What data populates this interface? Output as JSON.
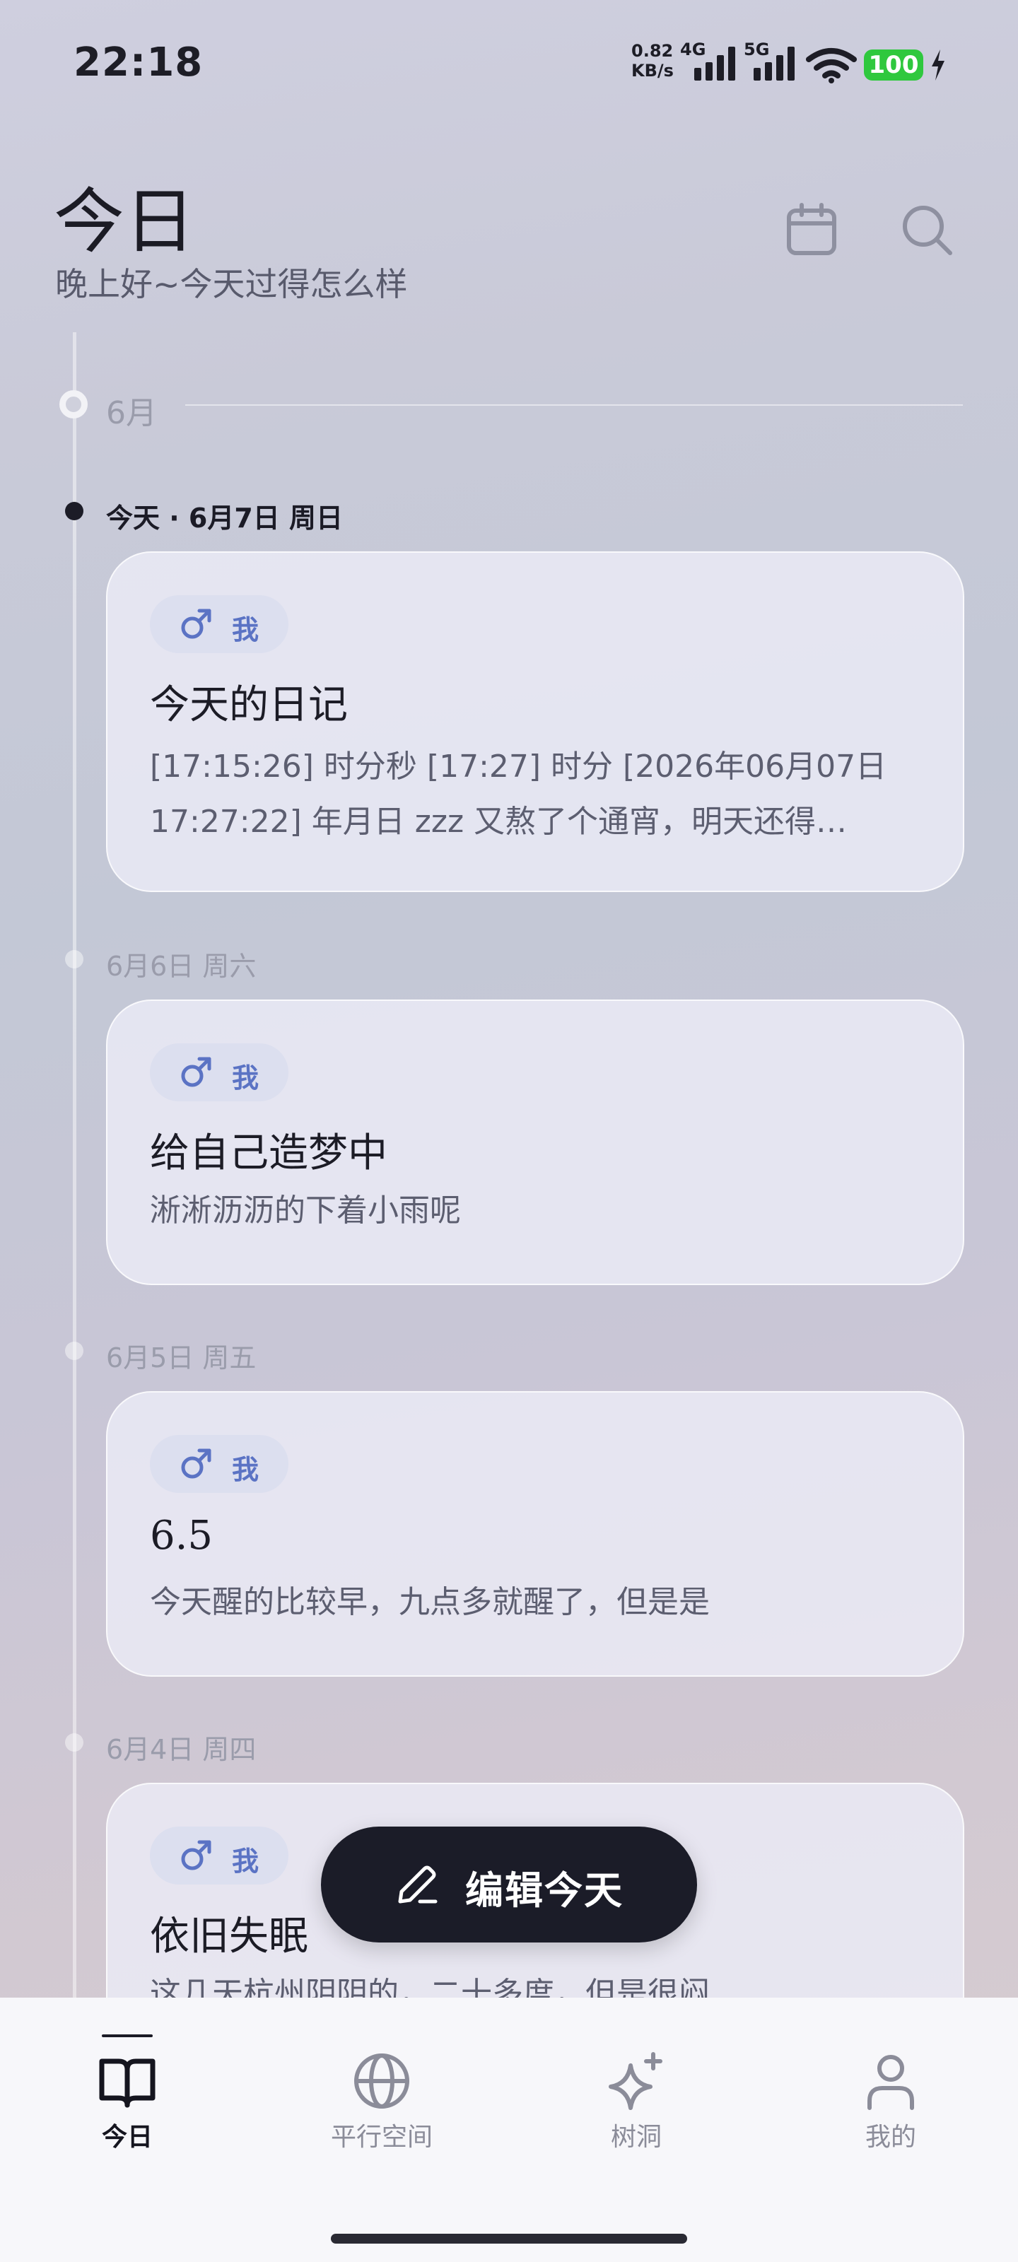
{
  "status_bar": {
    "time": "22:18",
    "net_speed_value": "0.82",
    "net_speed_unit": "KB/s",
    "network_4g": "4G",
    "network_5g": "5G",
    "battery": "100"
  },
  "header": {
    "title": "今日",
    "subtitle": "晚上好~今天过得怎么样"
  },
  "timeline": {
    "month": "6月",
    "days": [
      {
        "label": "今天 · 6月7日 周日",
        "author": "我",
        "title": "今天的日记",
        "body": "[17:15:26] 时分秒 [17:27] 时分 [2026年06月07日 17:27:22] 年月日 zzz 又熬了个通宵，明天还得…"
      },
      {
        "label": "6月6日 周六",
        "author": "我",
        "title": "给自己造梦中",
        "body": "淅淅沥沥的下着小雨呢"
      },
      {
        "label": "6月5日 周五",
        "author": "我",
        "title": "6.5",
        "body": "今天醒的比较早，九点多就醒了，但是是"
      },
      {
        "label": "6月4日 周四",
        "author": "我",
        "title": "依旧失眠",
        "body": "这几天杭州阴阴的，二十多度，但是很闷"
      }
    ]
  },
  "fab": {
    "label": "编辑今天"
  },
  "bottom_nav": {
    "items": [
      {
        "label": "今日",
        "icon": "book-icon",
        "active": true
      },
      {
        "label": "平行空间",
        "icon": "globe-icon",
        "active": false
      },
      {
        "label": "树洞",
        "icon": "sparkle-icon",
        "active": false
      },
      {
        "label": "我的",
        "icon": "person-icon",
        "active": false
      }
    ]
  },
  "colors": {
    "accent_dark": "#1b1c28",
    "chip_text": "#5b73c4",
    "battery_green": "#2fc83e"
  }
}
